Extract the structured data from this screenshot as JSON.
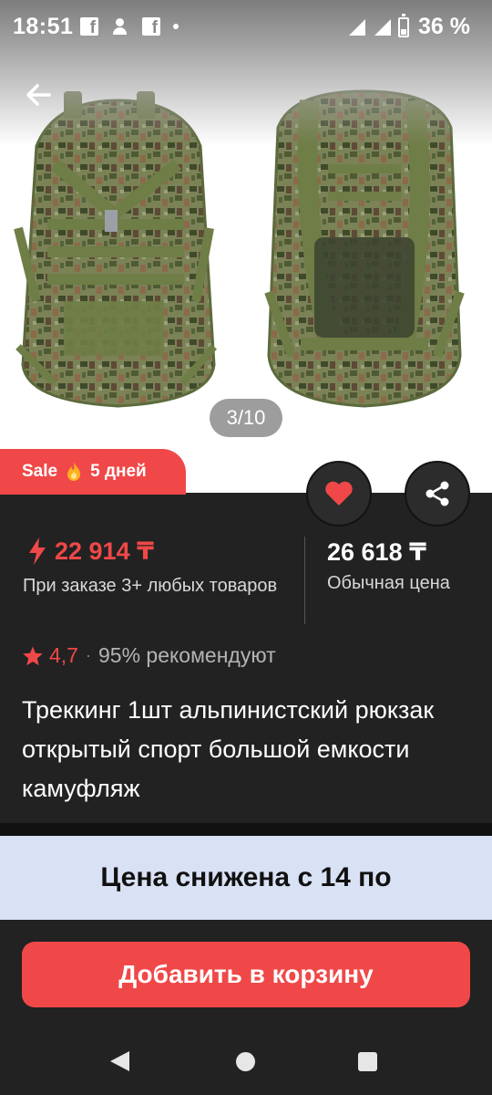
{
  "status_bar": {
    "time": "18:51",
    "battery": "36 %",
    "icons": [
      "facebook-icon",
      "person-add-icon",
      "facebook-icon",
      "dot-icon",
      "signal-icon",
      "signal-icon",
      "battery-icon"
    ]
  },
  "gallery": {
    "counter": "3/10"
  },
  "sale_tag": {
    "label": "Sale",
    "icon": "fire-icon",
    "days": "5 дней"
  },
  "prices": {
    "sale_price": "22 914 ₸",
    "sale_note": "При заказе 3+ любых товаров",
    "regular_price": "26 618 ₸",
    "regular_note": "Обычная цена"
  },
  "rating": {
    "value": "4,7",
    "separator": "·",
    "recommend": "95% рекомендуют"
  },
  "product": {
    "title": "Треккинг 1шт альпинистский рюкзак открытый спорт большой емкости камуфляж"
  },
  "promo_banner": {
    "text": "Цена снижена с 14 по"
  },
  "actions": {
    "add_to_cart": "Добавить в корзину"
  },
  "colors": {
    "accent": "#f04848",
    "panel": "#222222",
    "promo_bg": "#d9e1f5"
  }
}
